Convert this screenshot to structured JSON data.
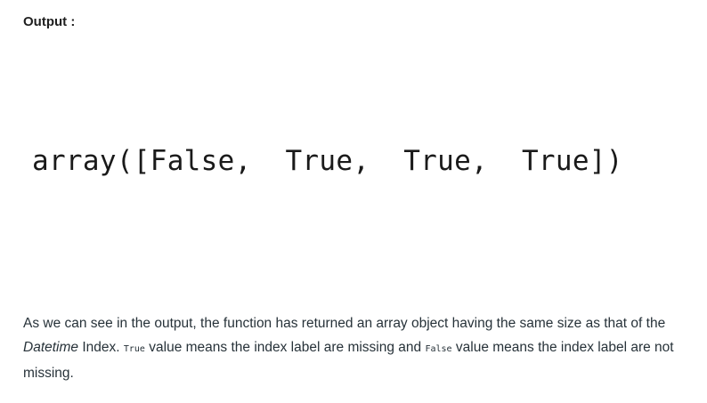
{
  "header": {
    "label": "Output :"
  },
  "code_output": {
    "text": "array([False,  True,  True,  True])"
  },
  "description": {
    "part1": "As we can see in the output, the function has returned an array object having the same size as that of the ",
    "emphasis": "Datetime",
    "part2": " Index. ",
    "code_true": "True",
    "part3": " value means the index label are missing and ",
    "code_false": "False",
    "part4": " value means the index label are not missing."
  }
}
